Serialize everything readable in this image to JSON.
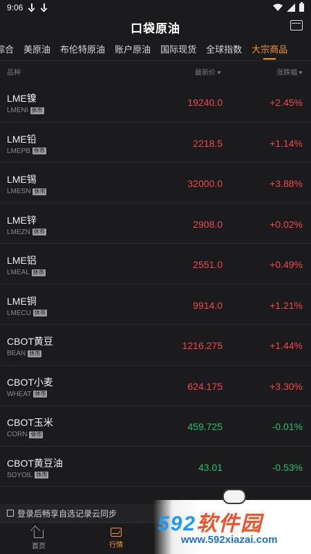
{
  "status_bar": {
    "time": "9:06"
  },
  "header": {
    "title": "口袋原油"
  },
  "tabs": [
    "综合",
    "美原油",
    "布伦特原油",
    "账户原油",
    "国际现货",
    "全球指数",
    "大宗商品"
  ],
  "active_tab": "大宗商品",
  "columns": {
    "name": "品种",
    "price": "最新价",
    "change": "涨跌幅"
  },
  "rows": [
    {
      "name": "LME镍",
      "code": "LMENI",
      "badge": "休市",
      "price": "19240.0",
      "change": "+2.45%",
      "dir": "up"
    },
    {
      "name": "LME铅",
      "code": "LMEPB",
      "badge": "休市",
      "price": "2218.5",
      "change": "+1.14%",
      "dir": "up"
    },
    {
      "name": "LME锡",
      "code": "LMESN",
      "badge": "休市",
      "price": "32000.0",
      "change": "+3.88%",
      "dir": "up"
    },
    {
      "name": "LME锌",
      "code": "LMEZN",
      "badge": "休市",
      "price": "2908.0",
      "change": "+0.02%",
      "dir": "up"
    },
    {
      "name": "LME铝",
      "code": "LMEAL",
      "badge": "休市",
      "price": "2551.0",
      "change": "+0.49%",
      "dir": "up"
    },
    {
      "name": "LME铜",
      "code": "LMECU",
      "badge": "休市",
      "price": "9914.0",
      "change": "+1.21%",
      "dir": "up"
    },
    {
      "name": "CBOT黄豆",
      "code": "BEAN",
      "badge": "休市",
      "price": "1216.275",
      "change": "+1.44%",
      "dir": "up"
    },
    {
      "name": "CBOT小麦",
      "code": "WHEAT",
      "badge": "休市",
      "price": "624.175",
      "change": "+3.30%",
      "dir": "up"
    },
    {
      "name": "CBOT玉米",
      "code": "CORN",
      "badge": "休市",
      "price": "459.725",
      "change": "-0.01%",
      "dir": "down"
    },
    {
      "name": "CBOT黄豆油",
      "code": "SOYOIL",
      "badge": "休市",
      "price": "43.01",
      "change": "-0.53%",
      "dir": "down"
    }
  ],
  "login_bar": {
    "text": "登录后畅享自选记录云同步"
  },
  "bottom_nav": [
    {
      "label": "首页",
      "icon": "home-icon"
    },
    {
      "label": "行情",
      "icon": "quote-icon"
    }
  ],
  "watermark": {
    "main_num": "592",
    "main_text": "软件园",
    "url": "www.592xiazai.com"
  },
  "colors": {
    "accent": "#f39a2b",
    "up": "#f04848",
    "down": "#27c06a",
    "background": "#1b1b1d"
  }
}
